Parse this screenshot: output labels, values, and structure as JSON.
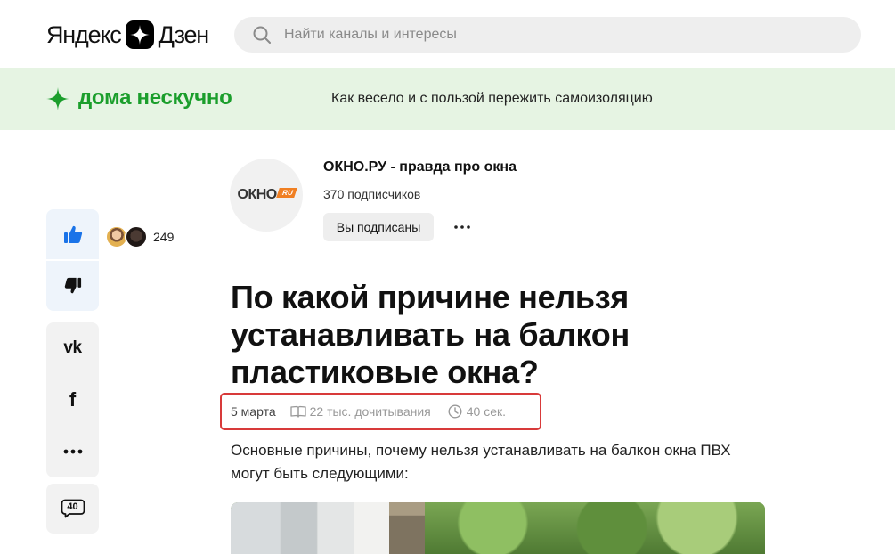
{
  "header": {
    "logo_left": "Яндекс",
    "logo_right": "Дзен",
    "search_placeholder": "Найти каналы и интересы"
  },
  "banner": {
    "title": "дома нескучно",
    "subtitle": "Как весело и с пользой пережить самоизоляцию",
    "accent_color": "#1b9e2c",
    "background_color": "#e6f4e3"
  },
  "reactions": {
    "likes_count": "249",
    "comments_count": "40"
  },
  "channel": {
    "logo_word": "ОКНО",
    "logo_suffix": ".RU",
    "name": "ОКНО.РУ - правда про окна",
    "subscribers": "370 подписчиков",
    "subscribe_label": "Вы подписаны"
  },
  "article": {
    "title": "По какой причине нельзя устанавливать на балкон пластиковые окна?",
    "date": "5 марта",
    "reads": "22 тыс. дочитывания",
    "read_time": "40 сек.",
    "intro": "Основные причины, почему нельзя устанавливать на балкон окна ПВХ могут быть следующими:"
  },
  "icons": {
    "search": "search-icon",
    "like": "thumbs-up-icon",
    "dislike": "thumbs-down-icon",
    "vk": "vk-icon",
    "facebook": "facebook-icon",
    "more": "more-dots-icon",
    "comments": "comment-bubble-icon",
    "reads": "book-icon",
    "time": "clock-icon"
  },
  "colors": {
    "like_blue": "#1a73e8",
    "highlight_red": "#d83a3a",
    "okno_orange": "#f07f22"
  }
}
